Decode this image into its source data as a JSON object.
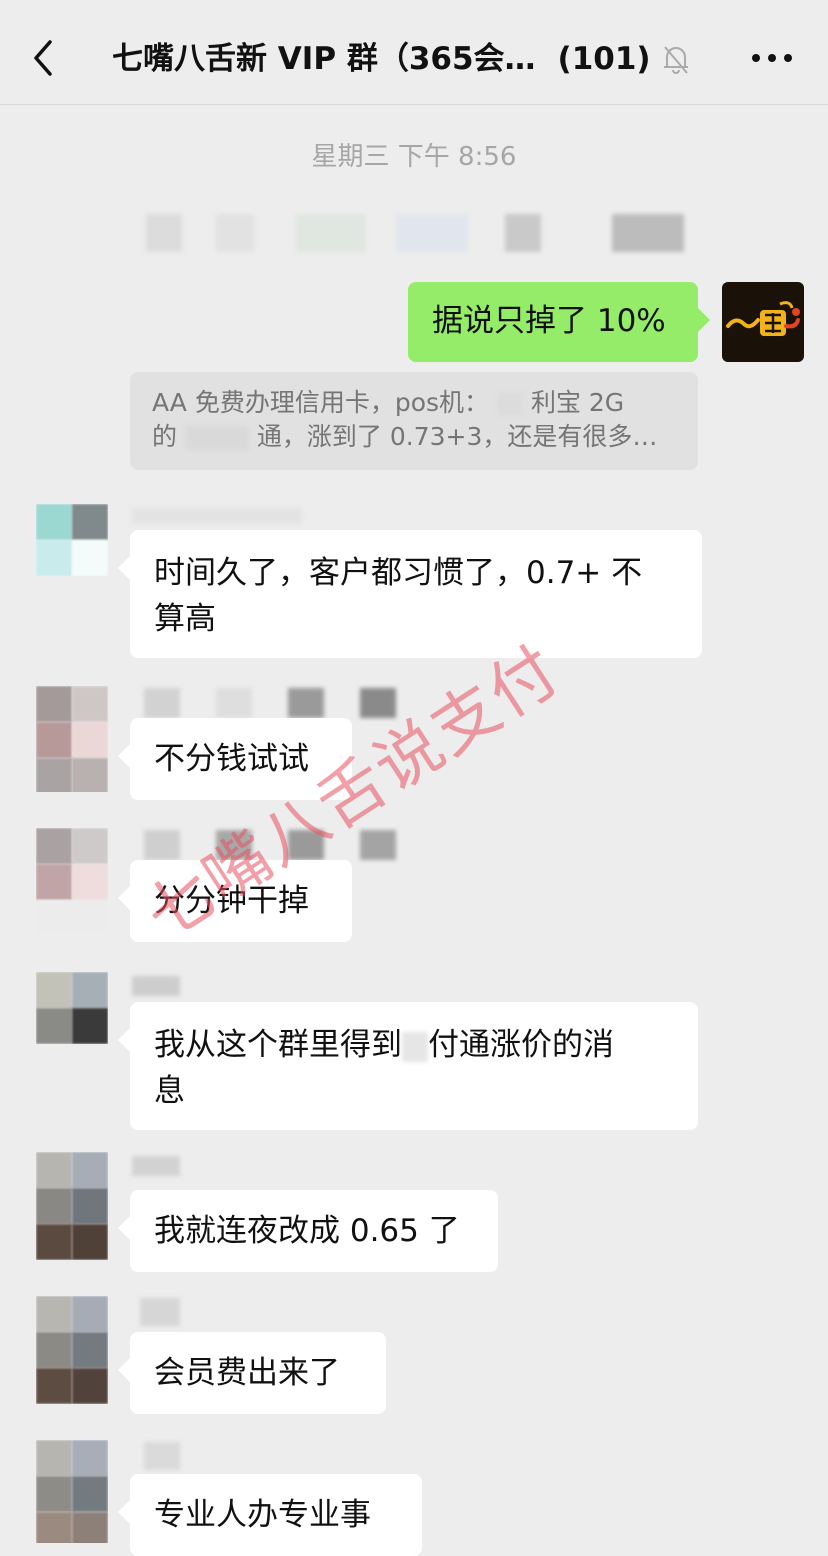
{
  "header": {
    "back_icon": "chevron-left-icon",
    "title": "七嘴八舌新 VIP 群（365会…",
    "member_count": "(101)",
    "mute_icon": "bell-off-icon",
    "more_icon": "more-dots-icon"
  },
  "timestamp": "星期三 下午 8:56",
  "messages": [
    {
      "side": "right",
      "text": "据说只掉了 10%",
      "color": "#95ec69"
    },
    {
      "side": "quote",
      "lines": [
        "AA 免费办理信用卡，pos机：",
        "利宝 2G",
        "的",
        "通，涨到了 0.73+3，还是有很多…"
      ]
    },
    {
      "side": "left",
      "text_line1": "时间久了，客户都习惯了，0.7+ 不",
      "text_line2": "算高"
    },
    {
      "side": "left",
      "text": "不分钱试试"
    },
    {
      "side": "left",
      "text": "分分钟干掉"
    },
    {
      "side": "left",
      "text_line1a": "我从这个群里得到",
      "text_line1b": "付通涨价的消",
      "text_line2": "息"
    },
    {
      "side": "left",
      "text": "我就连夜改成 0.65 了"
    },
    {
      "side": "left",
      "text": "会员费出来了"
    },
    {
      "side": "left",
      "text": "专业人办专业事"
    }
  ],
  "watermark": "七嘴八舌说支付"
}
